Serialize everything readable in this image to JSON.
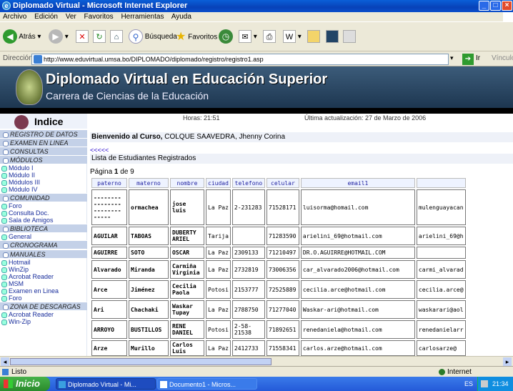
{
  "window": {
    "title": "Diplomado Virtual - Microsoft Internet Explorer"
  },
  "menu": [
    "Archivo",
    "Edición",
    "Ver",
    "Favoritos",
    "Herramientas",
    "Ayuda"
  ],
  "toolbar": {
    "back": "Atrás",
    "search": "Búsqueda",
    "favorites": "Favoritos"
  },
  "address": {
    "label": "Dirección",
    "url": "http://www.eduvirtual.umsa.bo/DIPLOMADO/diplomado/registro/registro1.asp",
    "go": "Ir",
    "links": "Vínculos"
  },
  "banner": {
    "title": "Diplomado Virtual en Educación Superior",
    "subtitle": "Carrera de Ciencias de la Educación"
  },
  "sidebar": {
    "title": "Indice",
    "sections": [
      {
        "label": "REGISTRO DE DATOS",
        "items": []
      },
      {
        "label": "EXAMEN EN LINEA",
        "items": []
      },
      {
        "label": "CONSULTAS",
        "items": []
      },
      {
        "label": "MÓDULOS",
        "items": [
          "Módulo I",
          "Módulo II",
          "Módulos III",
          "Módulo IV"
        ]
      },
      {
        "label": "COMUNIDAD",
        "items": [
          "Foro",
          "Consulta Doc.",
          "Sala de Amigos"
        ]
      },
      {
        "label": "BIBLIOTECA",
        "items": [
          "General"
        ]
      },
      {
        "label": "CRONOGRAMA",
        "items": []
      },
      {
        "label": "MANUALES",
        "items": [
          "Hotmail",
          "WinZip",
          "Acrobat Reader",
          "MSM",
          "Examen en Linea",
          "Foro"
        ]
      },
      {
        "label": "ZONA DE DESCARGAS",
        "items": [
          "Acrobat Reader",
          "Win-Zip"
        ]
      }
    ]
  },
  "main": {
    "hours": "Horas: 21:51",
    "updated": "Última actualización: 27 de Marzo de 2006",
    "welcome_bold": "Bienvenido al Curso,",
    "welcome_name": " COLQUE SAAVEDRA, Jhenny Corina",
    "back": "<<<<<",
    "list_title": "Lista de Estudiantes Registrados",
    "page_prefix": "Página ",
    "page_num": "1",
    "page_suffix": " de 9"
  },
  "table": {
    "headers": [
      "paterno",
      "materno",
      "nombre",
      "ciudad",
      "telefono",
      "celular",
      "email1",
      ""
    ],
    "rows": [
      [
        "--------\n--------\n--------\n-----",
        "ormachea",
        "jose\nluis",
        "La Paz",
        "2-231283",
        "71528171",
        "luisorma@homail.com",
        "mulenguayacan"
      ],
      [
        "AGUILAR",
        "TABOAS",
        "DUBERTY\nARIEL",
        "Tarija",
        "",
        "71283590",
        "arielini_69@hotmail.com",
        "arielini_69@h"
      ],
      [
        "AGUIRRE",
        "SOTO",
        "OSCAR",
        "La Paz",
        "2309133",
        "71210497",
        "DR.O.AGUIRRE@HOTMAIL.COM",
        ""
      ],
      [
        "Alvarado",
        "Miranda",
        "Carmiña\nVirginia",
        "La Paz",
        "2732819",
        "73006356",
        "car_alvarado2006@hotmail.com",
        "carmi_alvarad"
      ],
      [
        "Arce",
        "Jiménez",
        "Cecilia\nPaola",
        "Potosi",
        "2153777",
        "72525889",
        "cecilia.arce@hotmail.com",
        "cecilia.arce@"
      ],
      [
        "Ari",
        "Chachaki",
        "Waskar\nTupay",
        "La Paz",
        "2788750",
        "71277040",
        "Waskar-ari@hotmail.com",
        "waskarari@aol"
      ],
      [
        "ARROYO",
        "BUSTILLOS",
        "RENE\nDANIEL",
        "Potosi",
        "2-58-\n21538",
        "71892651",
        "renedaniela@hotmail.com",
        "renedanielarr"
      ],
      [
        "Arze",
        "Murillo",
        "Carlos\nLuis",
        "La Paz",
        "2412733",
        "71558341",
        "carlos.arze@hotmail.com",
        "carlosarze@"
      ]
    ]
  },
  "status": {
    "left": "Listo",
    "zone": "Internet"
  },
  "taskbar": {
    "start": "Inicio",
    "tasks": [
      "Diplomado Virtual - Mi...",
      "Documento1 - Micros..."
    ],
    "lang": "ES",
    "clock": "21:34"
  }
}
